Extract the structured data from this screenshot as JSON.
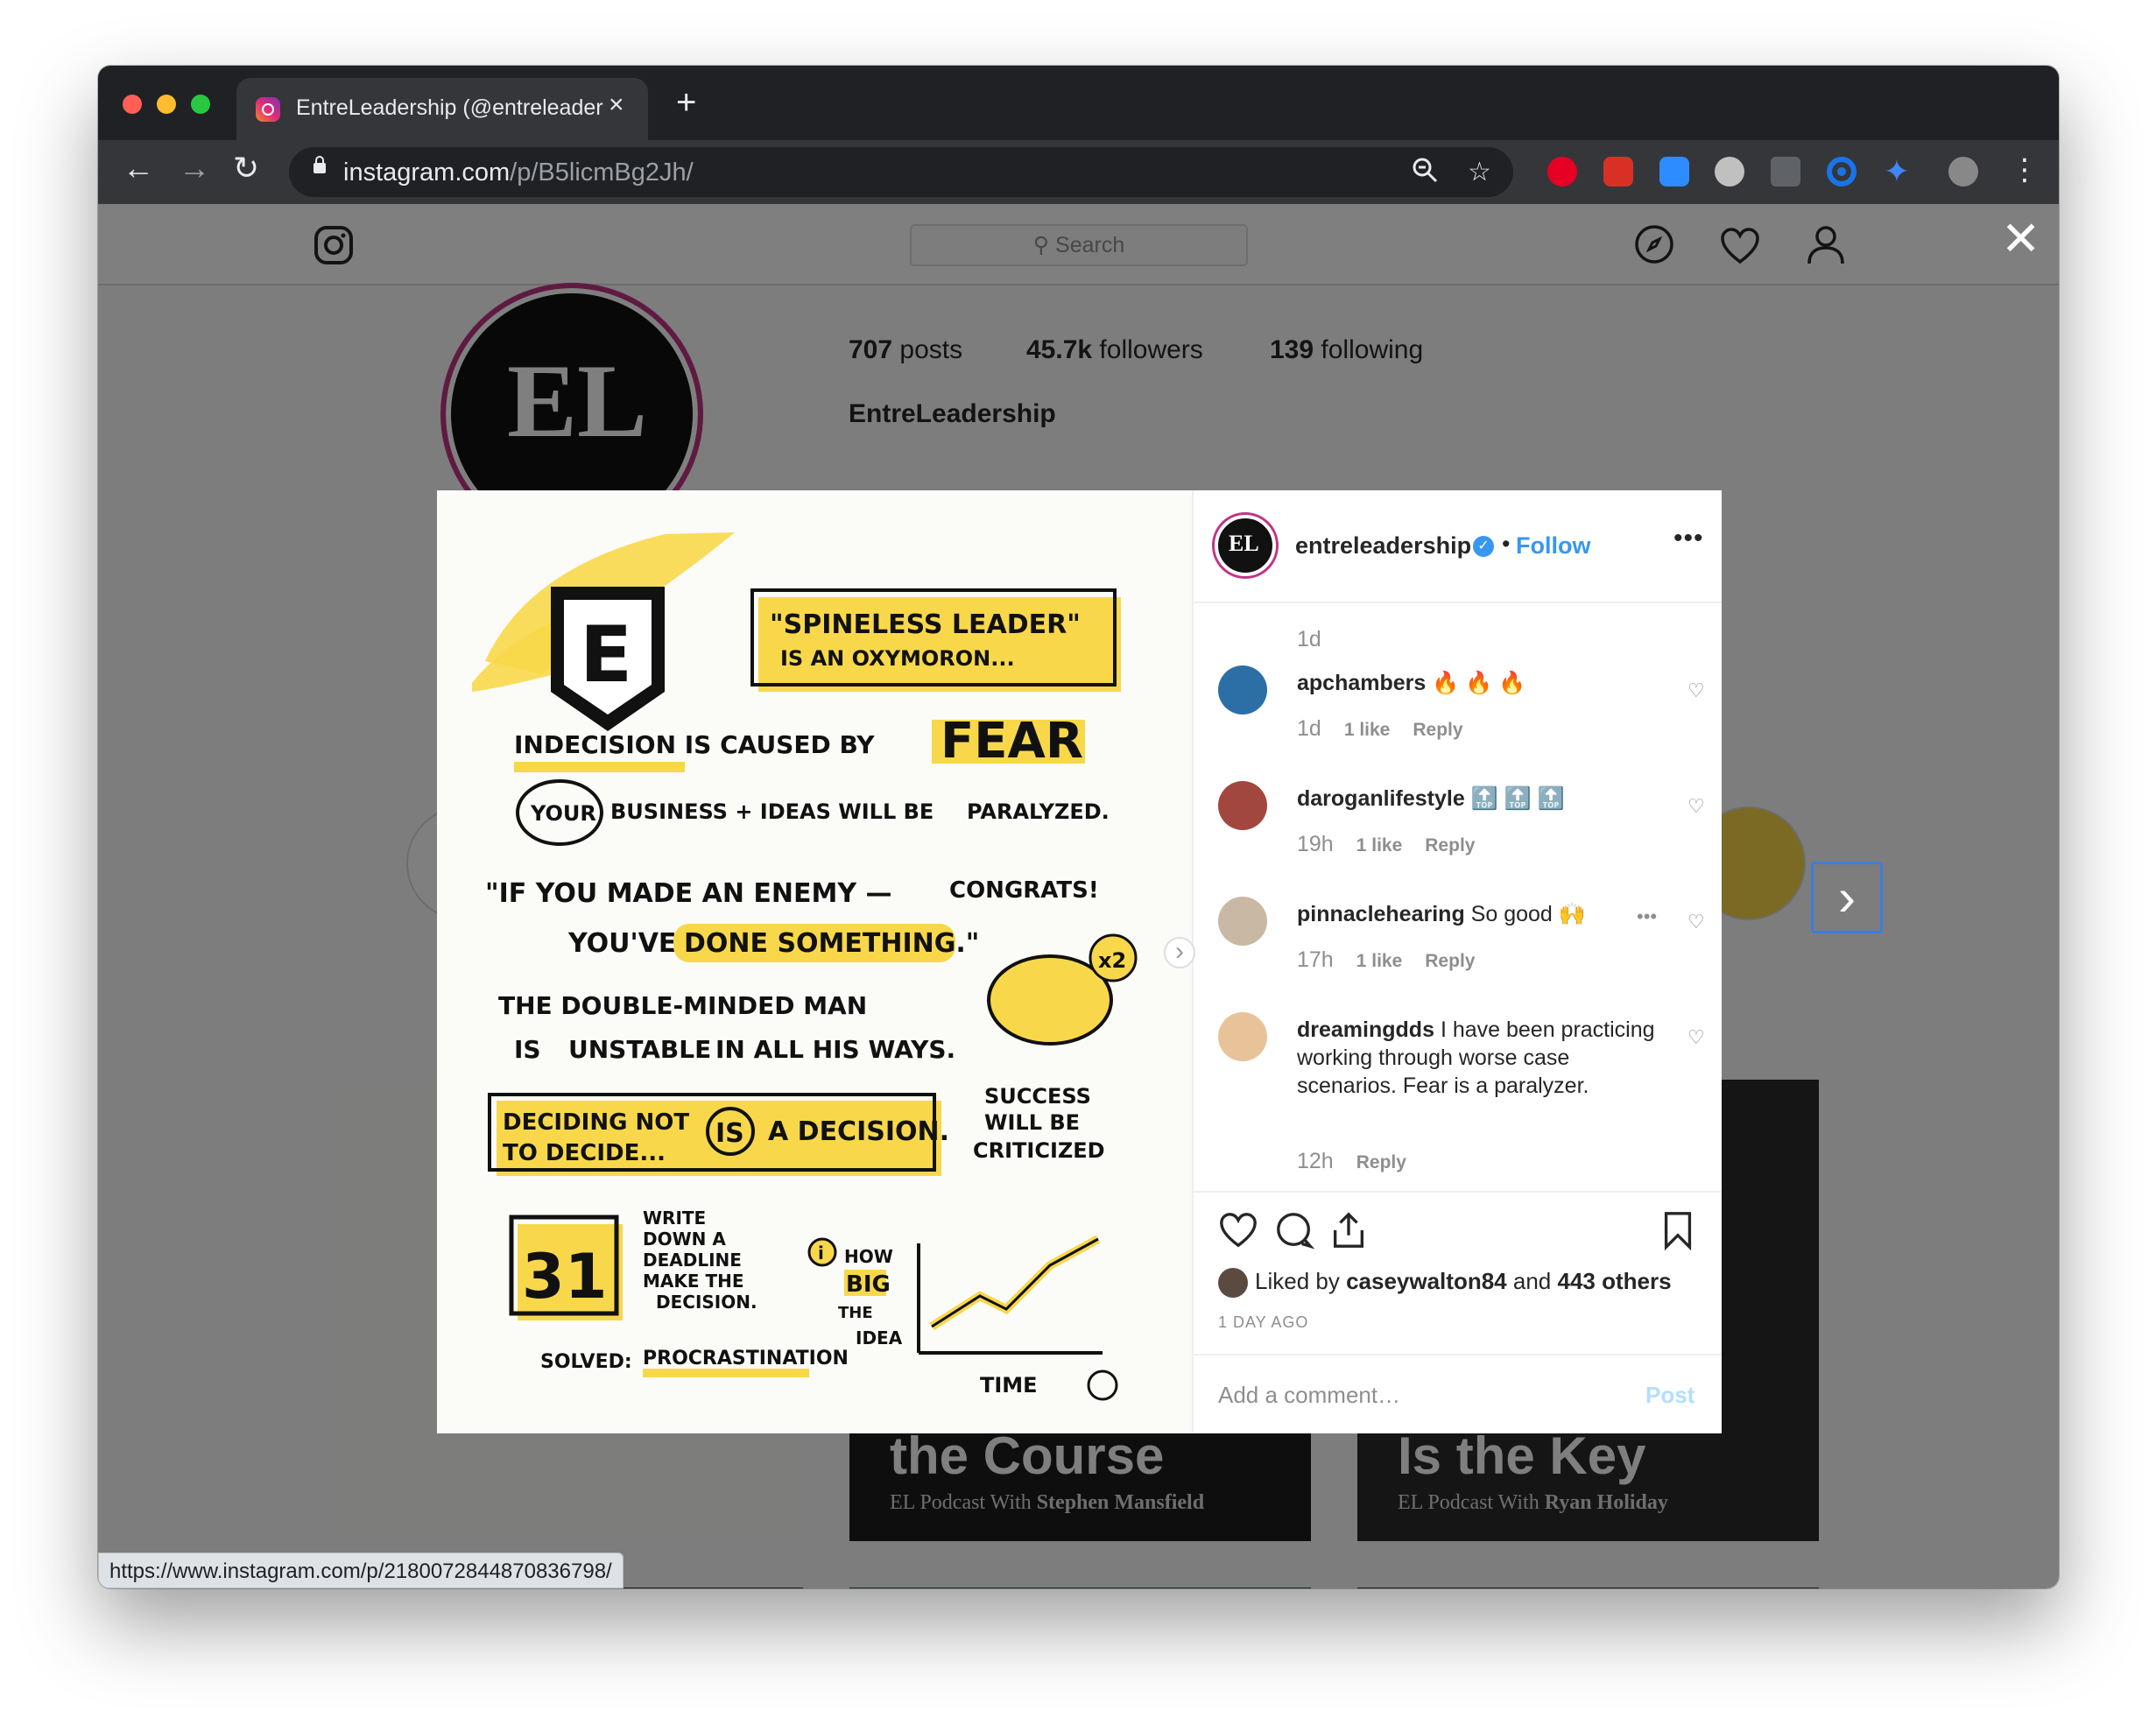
{
  "browser": {
    "tab_title": "EntreLeadership (@entreleader",
    "tab_close": "×",
    "new_tab": "+",
    "url_host": "instagram.com",
    "url_path": "/p/B5licmBg2Jh/",
    "status_url": "https://www.instagram.com/p/2180072844870836798/",
    "traffic_colors": [
      "#ff5f57",
      "#febc2e",
      "#28c840"
    ]
  },
  "ig": {
    "search_placeholder": "Search",
    "overlay_close": "✕",
    "profile": {
      "posts": "707",
      "posts_label": "posts",
      "followers": "45.7k",
      "followers_label": "followers",
      "following": "139",
      "following_label": "following",
      "name": "EntreLeadership",
      "logo_text": "EL"
    },
    "grid_captions": [
      {
        "title": "the Course",
        "sub_prefix": "EL",
        "sub": "Podcast With",
        "guest": "Stephen Mansfield"
      },
      {
        "title": "Is the Key",
        "sub_prefix": "EL",
        "sub": "Podcast With",
        "guest": "Ryan Holiday"
      }
    ]
  },
  "post": {
    "username": "entreleadership",
    "avatar_text": "EL",
    "follow_dot": "•",
    "follow": "Follow",
    "more": "•••",
    "top_time": "1d",
    "comments": [
      {
        "user": "apchambers",
        "text": "🔥 🔥 🔥",
        "time": "1d",
        "likes": "1 like",
        "reply": "Reply",
        "color": "#2b6fa6"
      },
      {
        "user": "daroganlifestyle",
        "text": "🔝 🔝 🔝",
        "time": "19h",
        "likes": "1 like",
        "reply": "Reply",
        "color": "#a1473f"
      },
      {
        "user": "pinnaclehearing",
        "text": "So good 🙌",
        "time": "17h",
        "likes": "1 like",
        "reply": "Reply",
        "color": "#c9b9a4"
      },
      {
        "user": "dreamingdds",
        "text": "I have been practicing working through worse case scenarios. Fear is a paralyzer.",
        "time": "12h",
        "likes": "",
        "reply": "Reply",
        "color": "#e8c39a"
      }
    ],
    "comment_more": "•••",
    "liked_by_prefix": "Liked by",
    "liked_by_user": "caseywalton84",
    "liked_by_and": "and",
    "liked_by_others": "443 others",
    "days_ago": "1 DAY AGO",
    "add_comment_placeholder": "Add a comment…",
    "post_button": "Post"
  },
  "sketch": {
    "quote1_a": "\"SPINELESS LEADER\"",
    "quote1_b": "IS AN OXYMORON...",
    "line1": "INDECISION IS CAUSED BY",
    "fear": "FEAR",
    "line2_your": "YOUR",
    "line2_rest": "BUSINESS + IDEAS WILL BE",
    "paralyzed": "PARALYZED.",
    "quote2_a": "\"IF YOU MADE AN ENEMY —",
    "congrats": "CONGRATS!",
    "quote2_b": "YOU'VE",
    "done": "DONE SOMETHING.\"",
    "line3_a": "THE DOUBLE-MINDED MAN",
    "line3_b": "IS",
    "unstable": "UNSTABLE",
    "line3_c": "IN ALL HIS WAYS.",
    "x2": "x2",
    "success_a": "SUCCESS",
    "success_b": "WILL BE",
    "success_c": "CRITICIZED",
    "decide_a": "DECIDING NOT",
    "decide_b": "TO DECIDE...",
    "is": "IS",
    "a_decision": "A DECISION.",
    "cal_num": "31",
    "write_a": "WRITE",
    "write_b": "DOWN A",
    "write_c": "DEADLINE",
    "write_d": "MAKE THE",
    "write_e": "DECISION.",
    "solved": "SOLVED:",
    "procrastination": "PROCRASTINATION",
    "how": "HOW",
    "big": "BIG",
    "the": "THE",
    "idea": "IDEA",
    "time": "TIME",
    "logo_letter": "E",
    "info_mark": "i"
  }
}
